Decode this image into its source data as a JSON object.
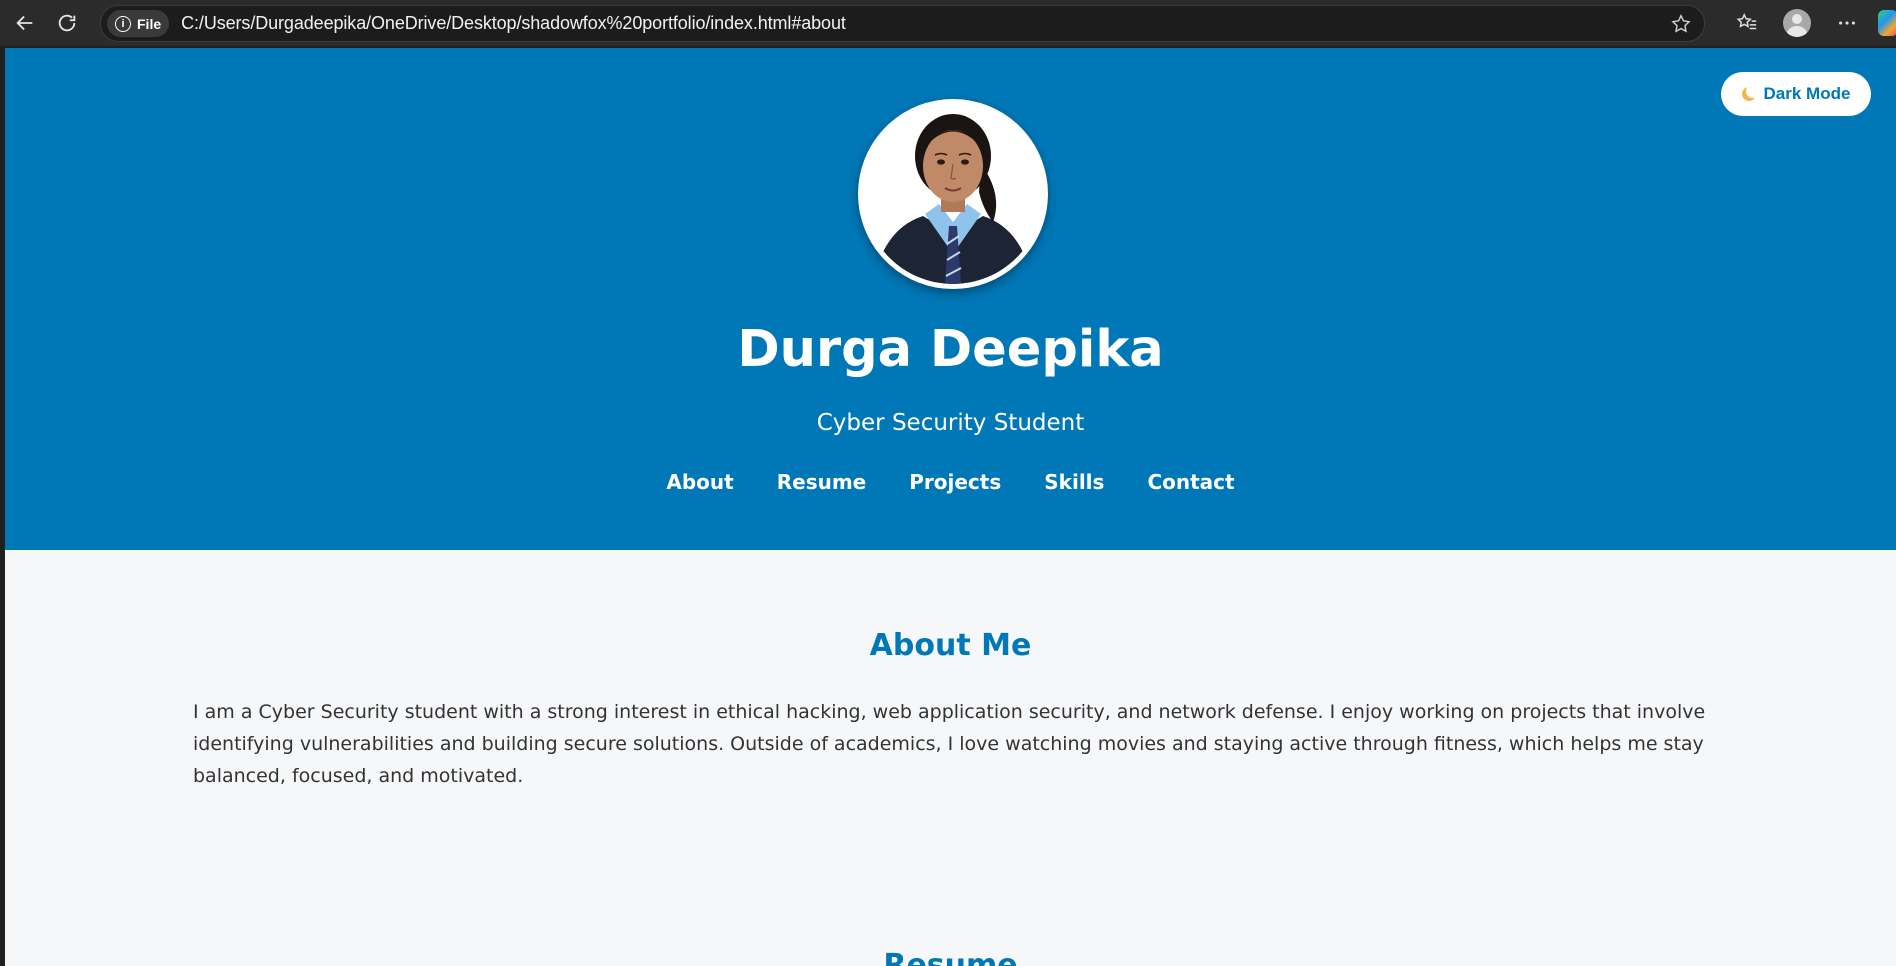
{
  "browser": {
    "file_chip": "File",
    "url": "C:/Users/Durgadeepika/OneDrive/Desktop/shadowfox%20portfolio/index.html#about"
  },
  "hero": {
    "dark_mode_label": "Dark Mode",
    "name": "Durga Deepika",
    "role": "Cyber Security Student",
    "nav": [
      "About",
      "Resume",
      "Projects",
      "Skills",
      "Contact"
    ]
  },
  "about": {
    "title": "About Me",
    "text": "I am a Cyber Security student with a strong interest in ethical hacking, web application security, and network defense. I enjoy working on projects that involve identifying vulnerabilities and building secure solutions. Outside of academics, I love watching movies and staying active through fitness, which helps me stay balanced, focused, and motivated."
  },
  "resume": {
    "title": "Resume"
  },
  "colors": {
    "primary": "#0077b6",
    "page_bg": "#f6f7f9",
    "chrome_bg": "#2b2b2b"
  }
}
